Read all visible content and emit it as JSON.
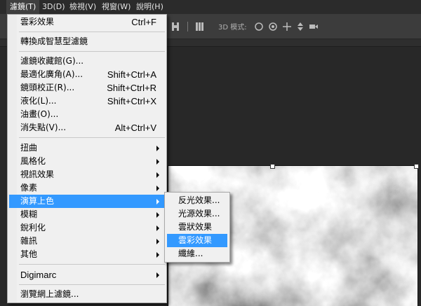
{
  "menubar": {
    "items": [
      "濾鏡(T)",
      "3D(D)",
      "檢視(V)",
      "視窗(W)",
      "說明(H)"
    ],
    "active_index": 0
  },
  "optionsbar": {
    "mode_label": "3D 模式:"
  },
  "filter_menu": {
    "items": [
      {
        "label": "雲彩效果",
        "shortcut": "Ctrl+F"
      },
      {
        "label": "轉換成智慧型濾鏡",
        "shortcut": ""
      },
      {
        "label": "濾鏡收藏館(G)...",
        "shortcut": ""
      },
      {
        "label": "最適化廣角(A)...",
        "shortcut": "Shift+Ctrl+A"
      },
      {
        "label": "鏡頭校正(R)...",
        "shortcut": "Shift+Ctrl+R"
      },
      {
        "label": "液化(L)...",
        "shortcut": "Shift+Ctrl+X"
      },
      {
        "label": "油畫(O)...",
        "shortcut": ""
      },
      {
        "label": "消失點(V)...",
        "shortcut": "Alt+Ctrl+V"
      },
      {
        "label": "扭曲",
        "shortcut": ""
      },
      {
        "label": "風格化",
        "shortcut": ""
      },
      {
        "label": "視訊效果",
        "shortcut": ""
      },
      {
        "label": "像素",
        "shortcut": ""
      },
      {
        "label": "演算上色",
        "shortcut": ""
      },
      {
        "label": "模糊",
        "shortcut": ""
      },
      {
        "label": "銳利化",
        "shortcut": ""
      },
      {
        "label": "雜訊",
        "shortcut": ""
      },
      {
        "label": "其他",
        "shortcut": ""
      },
      {
        "label": "Digimarc",
        "shortcut": ""
      },
      {
        "label": "瀏覽網上濾鏡...",
        "shortcut": ""
      }
    ]
  },
  "render_submenu": {
    "items": [
      "反光效果...",
      "光源效果...",
      "雲狀效果",
      "雲彩效果",
      "纖維..."
    ]
  },
  "colors": {
    "highlight": "#3399ff",
    "menu_bg": "#f0f0f0",
    "menubar_bg": "#2b2b2b",
    "workspace_bg": "#282828"
  }
}
